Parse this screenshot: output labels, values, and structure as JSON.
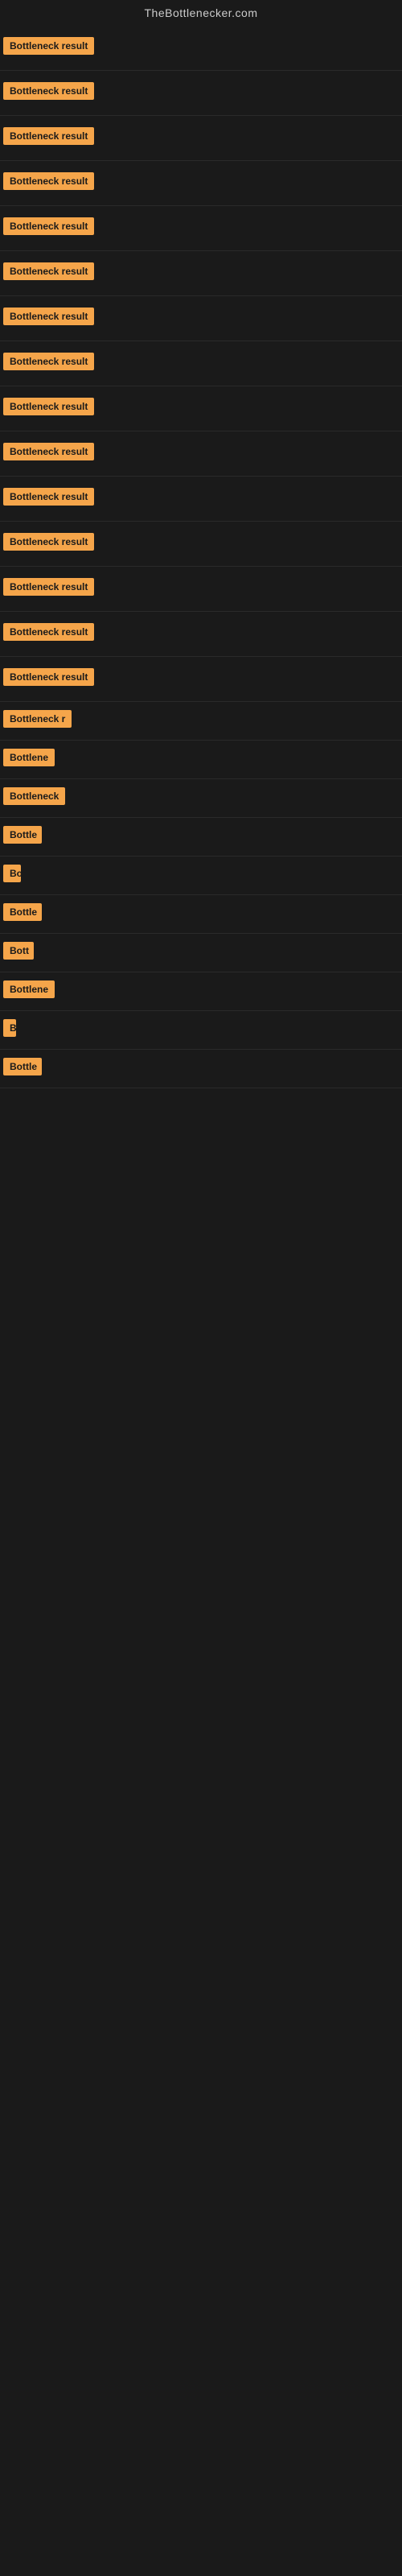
{
  "site": {
    "title": "TheBottlenecker.com"
  },
  "badges": [
    {
      "id": 1,
      "label": "Bottleneck result",
      "truncated": false
    },
    {
      "id": 2,
      "label": "Bottleneck result",
      "truncated": false
    },
    {
      "id": 3,
      "label": "Bottleneck result",
      "truncated": false
    },
    {
      "id": 4,
      "label": "Bottleneck result",
      "truncated": false
    },
    {
      "id": 5,
      "label": "Bottleneck result",
      "truncated": false
    },
    {
      "id": 6,
      "label": "Bottleneck result",
      "truncated": false
    },
    {
      "id": 7,
      "label": "Bottleneck result",
      "truncated": false
    },
    {
      "id": 8,
      "label": "Bottleneck result",
      "truncated": false
    },
    {
      "id": 9,
      "label": "Bottleneck result",
      "truncated": false
    },
    {
      "id": 10,
      "label": "Bottleneck result",
      "truncated": false
    },
    {
      "id": 11,
      "label": "Bottleneck result",
      "truncated": false
    },
    {
      "id": 12,
      "label": "Bottleneck result",
      "truncated": false
    },
    {
      "id": 13,
      "label": "Bottleneck result",
      "truncated": false
    },
    {
      "id": 14,
      "label": "Bottleneck result",
      "truncated": false
    },
    {
      "id": 15,
      "label": "Bottleneck result",
      "truncated": false
    },
    {
      "id": 16,
      "label": "Bottleneck r",
      "truncated": true
    },
    {
      "id": 17,
      "label": "Bottlene",
      "truncated": true
    },
    {
      "id": 18,
      "label": "Bottleneck",
      "truncated": true
    },
    {
      "id": 19,
      "label": "Bottle",
      "truncated": true
    },
    {
      "id": 20,
      "label": "Bo",
      "truncated": true
    },
    {
      "id": 21,
      "label": "Bottle",
      "truncated": true
    },
    {
      "id": 22,
      "label": "Bott",
      "truncated": true
    },
    {
      "id": 23,
      "label": "Bottlene",
      "truncated": true
    },
    {
      "id": 24,
      "label": "B",
      "truncated": true
    },
    {
      "id": 25,
      "label": "Bottle",
      "truncated": true
    }
  ],
  "colors": {
    "badge_bg": "#f5a54a",
    "badge_text": "#1a1a1a",
    "background": "#1a1a1a",
    "title_text": "#cccccc"
  }
}
